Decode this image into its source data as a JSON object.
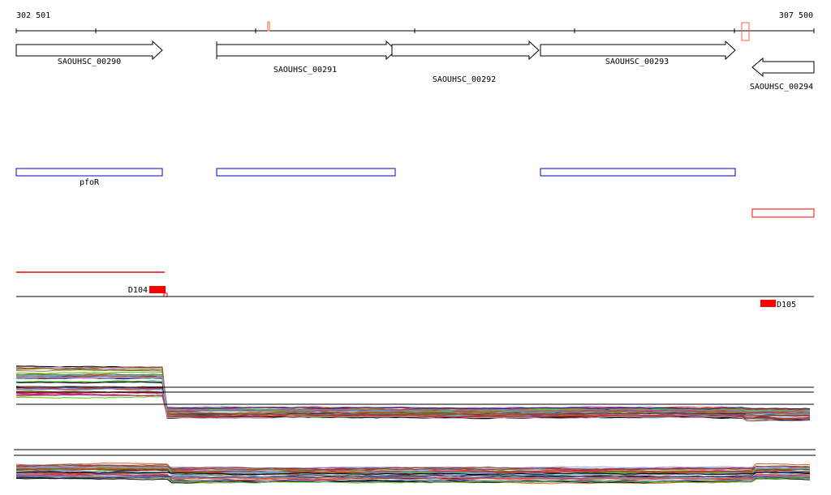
{
  "ruler": {
    "start_label": "302 501",
    "end_label": "307 500"
  },
  "genes": [
    {
      "name": "SAOUHSC_00290",
      "strand": "+"
    },
    {
      "name": "SAOUHSC_00291",
      "strand": "+"
    },
    {
      "name": "SAOUHSC_00292",
      "strand": "+"
    },
    {
      "name": "SAOUHSC_00293",
      "strand": "+"
    },
    {
      "name": "SAOUHSC_00294",
      "strand": "-"
    }
  ],
  "features": {
    "pfor_label": "pfoR"
  },
  "markers": {
    "left": "D104",
    "right": "D105"
  },
  "colors": {
    "gene_outline": "#000000",
    "blue_box": "#0000cc",
    "red": "#ff0000",
    "marker_orange": "#ff6633",
    "trace_palette": [
      "#000000",
      "#8b7d1a",
      "#d62020",
      "#e05a2a",
      "#9a3fa0",
      "#44cc11",
      "#55aaee",
      "#222266",
      "#cc2266",
      "#996633",
      "#888888",
      "#aa99dd",
      "#66bbff",
      "#7a4a2a"
    ]
  }
}
